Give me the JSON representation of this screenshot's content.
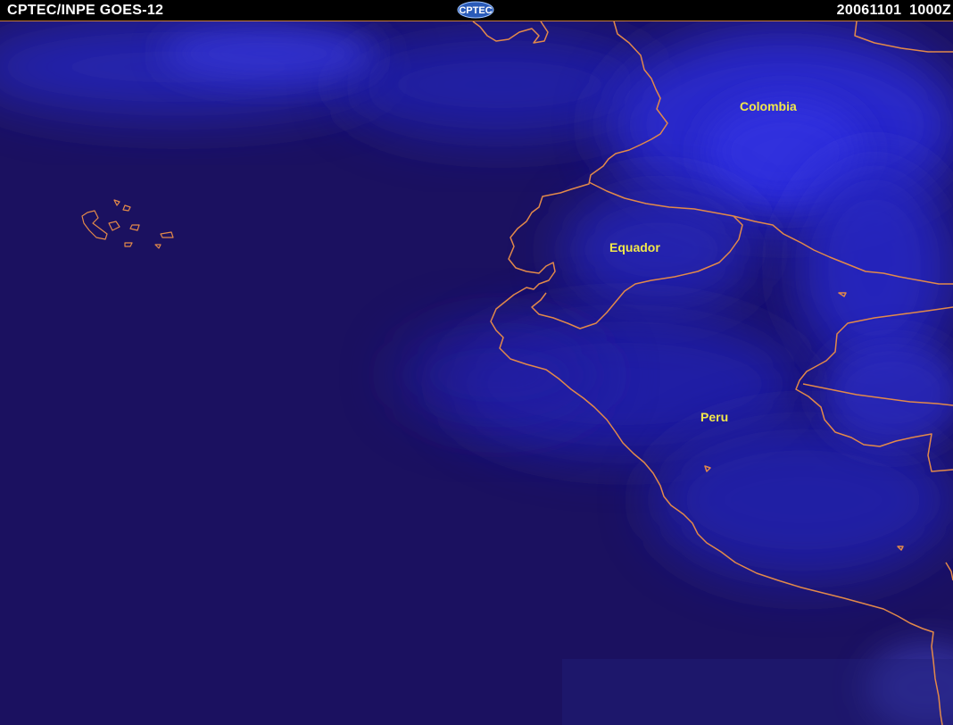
{
  "header": {
    "source_label": "CPTEC/INPE GOES-12",
    "datetime_label": "20061101  1000Z",
    "logo_text": "CPTEC"
  },
  "map": {
    "labels": {
      "colombia": "Colombia",
      "equador": "Equador",
      "peru": "Peru"
    },
    "colors": {
      "ocean": "#1b1160",
      "cloud": "#2a2ad0",
      "border": "#e2894a",
      "label": "#f2e84a"
    }
  }
}
